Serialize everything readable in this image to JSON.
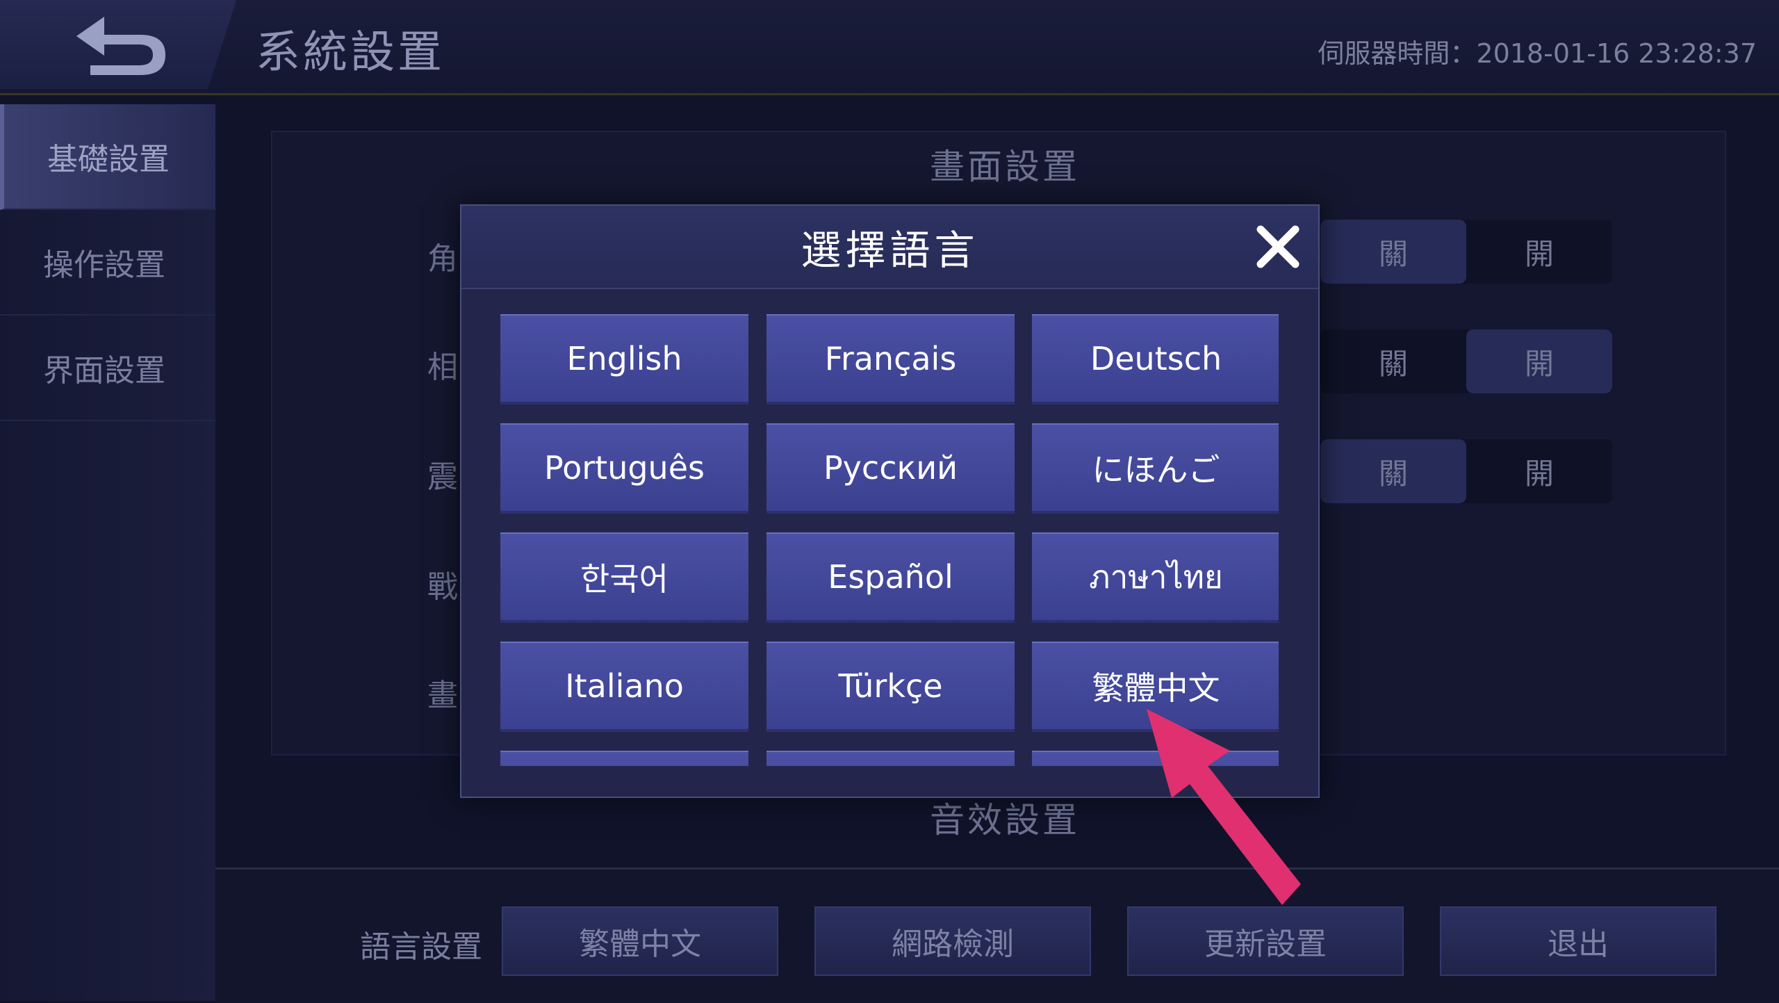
{
  "header": {
    "title": "系統設置",
    "server_time": "伺服器時間：2018-01-16 23:28:37"
  },
  "sidebar": {
    "items": [
      {
        "label": "基礎設置",
        "active": true
      },
      {
        "label": "操作設置",
        "active": false
      },
      {
        "label": "界面設置",
        "active": false
      }
    ]
  },
  "main": {
    "display_section": "畫面設置",
    "sound_section": "音效設置",
    "rows": [
      {
        "label": "角",
        "off": "關",
        "on": "開",
        "selected": "off"
      },
      {
        "label": "相",
        "off": "關",
        "on": "開",
        "selected": "on"
      },
      {
        "label": "震",
        "off": "關",
        "on": "開",
        "selected": "off"
      },
      {
        "label": "戰"
      },
      {
        "label": "畫"
      }
    ]
  },
  "bottom": {
    "language_label": "語言設置",
    "current_language": "繁體中文",
    "network_check": "網路檢測",
    "update_settings": "更新設置",
    "exit": "退出"
  },
  "dialog": {
    "title": "選擇語言",
    "close_icon": "close-x-icon",
    "languages": [
      "English",
      "Français",
      "Deutsch",
      "Português",
      "Русский",
      "にほんご",
      "한국어",
      "Español",
      "ภาษาไทย",
      "Italiano",
      "Türkçe",
      "繁體中文"
    ]
  },
  "colors": {
    "lang_button": "#4347a0",
    "dialog_bg": "#23264a",
    "annotation_arrow": "#e0306f"
  }
}
